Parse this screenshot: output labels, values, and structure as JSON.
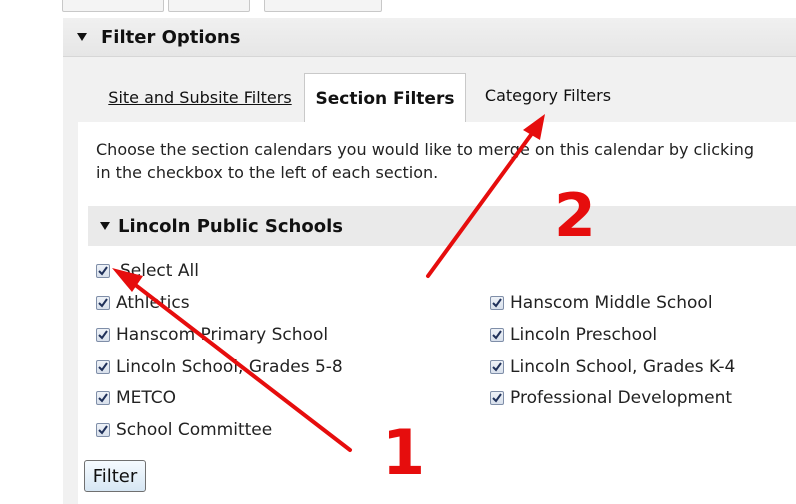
{
  "filter_options": {
    "title": "Filter Options"
  },
  "tabs": [
    {
      "label": "Site and Subsite Filters"
    },
    {
      "label": "Section Filters"
    },
    {
      "label": "Category Filters"
    }
  ],
  "description": {
    "line1": "Choose the section calendars you would like to merge on this calendar by clicking",
    "line2": "in the checkbox to the left of each section."
  },
  "section": {
    "title": "Lincoln Public Schools"
  },
  "select_all": {
    "label": "Select All",
    "checked": true
  },
  "checkboxes_left": [
    {
      "label": "Athletics",
      "checked": true
    },
    {
      "label": "Hanscom Primary School",
      "checked": true
    },
    {
      "label": "Lincoln School, Grades 5-8",
      "checked": true
    },
    {
      "label": "METCO",
      "checked": true
    },
    {
      "label": "School Committee",
      "checked": true
    }
  ],
  "checkboxes_right": [
    {
      "label": "Hanscom Middle School",
      "checked": true
    },
    {
      "label": "Lincoln Preschool",
      "checked": true
    },
    {
      "label": "Lincoln School, Grades K-4",
      "checked": true
    },
    {
      "label": "Professional Development",
      "checked": true
    }
  ],
  "filter_button": {
    "label": "Filter"
  },
  "annotations": {
    "one": "1",
    "two": "2",
    "color": "#e60d0d"
  },
  "icons": {
    "collapse": "triangle-down-icon",
    "checkbox": "checkmark-icon"
  }
}
